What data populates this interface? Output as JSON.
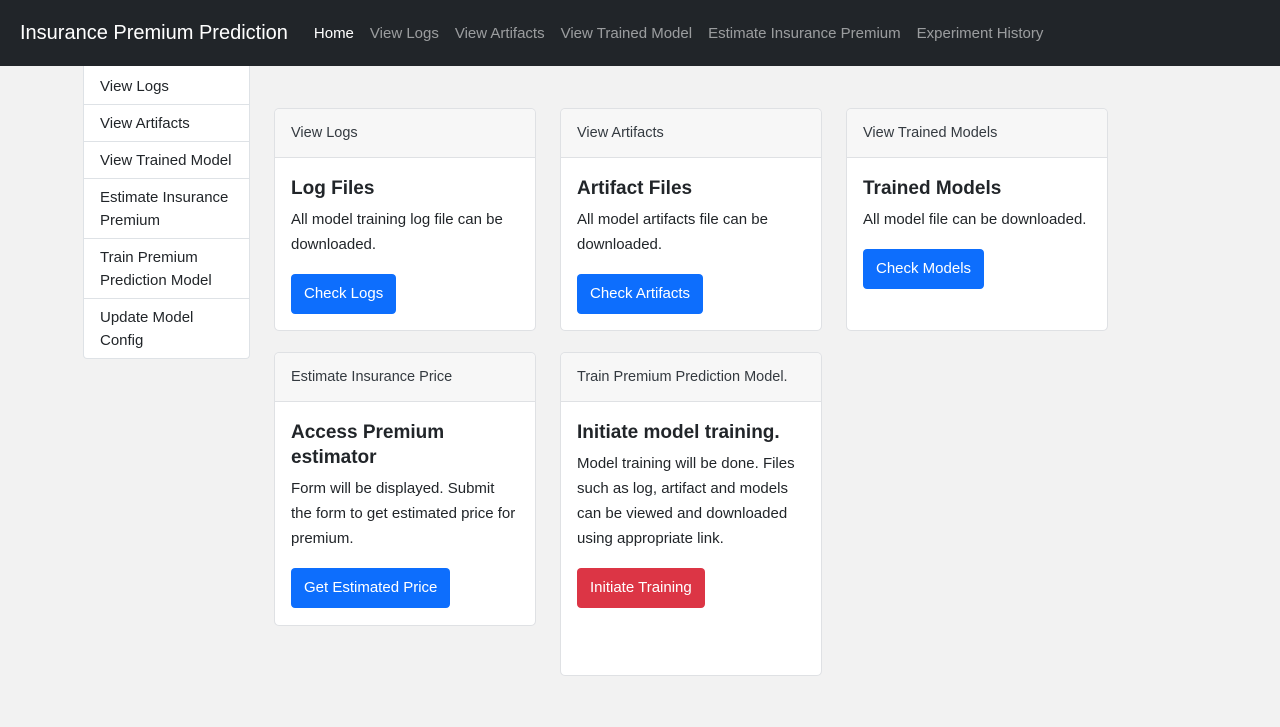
{
  "navbar": {
    "brand": "Insurance Premium Prediction",
    "links": [
      "Home",
      "View Logs",
      "View Artifacts",
      "View Trained Model",
      "Estimate Insurance Premium",
      "Experiment History"
    ]
  },
  "sidebar": {
    "items": [
      "View Logs",
      "View Artifacts",
      "View Trained Model",
      "Estimate Insurance Premium",
      "Train Premium Prediction Model",
      "Update Model Config"
    ]
  },
  "cards": {
    "logs": {
      "header": "View Logs",
      "title": "Log Files",
      "text": "All model training log file can be downloaded.",
      "button": "Check Logs"
    },
    "artifacts": {
      "header": "View Artifacts",
      "title": "Artifact Files",
      "text": "All model artifacts file can be downloaded.",
      "button": "Check Artifacts"
    },
    "models": {
      "header": "View Trained Models",
      "title": "Trained Models",
      "text": "All model file can be downloaded.",
      "button": "Check Models"
    },
    "estimate": {
      "header": "Estimate Insurance Price",
      "title": "Access Premium estimator",
      "text": "Form will be displayed. Submit the form to get estimated price for premium.",
      "button": "Get Estimated Price"
    },
    "train": {
      "header": "Train Premium Prediction Model.",
      "title": "Initiate model training.",
      "text": "Model training will be done. Files such as log, artifact and models can be viewed and downloaded using appropriate link.",
      "button": "Initiate Training"
    }
  },
  "colors": {
    "navbar_bg": "#212529",
    "primary": "#0d6efd",
    "danger": "#dc3545",
    "page_bg": "#f2f2f2"
  }
}
